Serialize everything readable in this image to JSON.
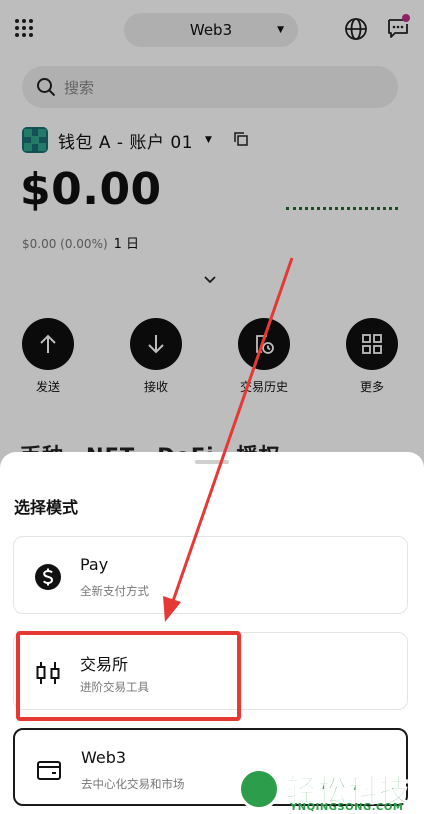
{
  "header": {
    "network": "Web3"
  },
  "search": {
    "placeholder": "搜索"
  },
  "wallet": {
    "name": "钱包 A - 账户 01"
  },
  "balance": {
    "amount": "$0.00",
    "change": "$0.00 (0.00%)",
    "period": "1 日"
  },
  "actions": [
    {
      "label": "发送",
      "icon": "arrow-up-icon"
    },
    {
      "label": "接收",
      "icon": "arrow-down-icon"
    },
    {
      "label": "交易历史",
      "icon": "history-icon"
    },
    {
      "label": "更多",
      "icon": "grid-four-icon"
    }
  ],
  "tabs_peek": [
    "币种",
    "NFT",
    "DeFi",
    "授权"
  ],
  "sheet": {
    "title": "选择模式",
    "options": [
      {
        "title": "Pay",
        "desc": "全新支付方式",
        "icon": "dollar-coin-icon"
      },
      {
        "title": "交易所",
        "desc": "进阶交易工具",
        "icon": "candlestick-icon"
      },
      {
        "title": "Web3",
        "desc": "去中心化交易和市场",
        "icon": "wallet-icon"
      }
    ]
  },
  "watermark": {
    "brand": "轻松科技",
    "domain": "YNQINGSONG.COM"
  },
  "colors": {
    "annotation": "#e53935",
    "notification_dot": "#c02d86",
    "watermark": "#2c9d4a"
  }
}
